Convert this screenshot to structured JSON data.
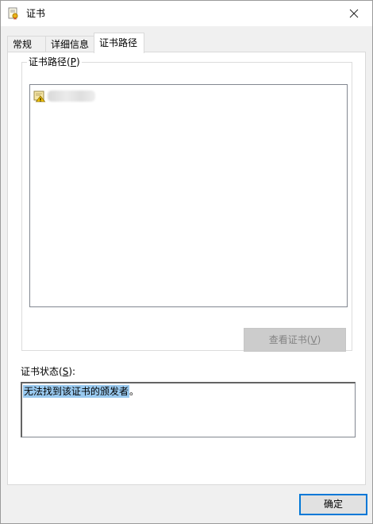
{
  "window": {
    "title": "证书"
  },
  "tabs": [
    {
      "label": "常规",
      "active": false
    },
    {
      "label": "详细信息",
      "active": false
    },
    {
      "label": "证书路径",
      "active": true
    }
  ],
  "cert_path_group": {
    "label": "证书路径(",
    "label_mnemonic": "P",
    "label_end": ")"
  },
  "view_button": {
    "label": "查看证书(",
    "mnemonic": "V",
    "end": ")",
    "enabled": false
  },
  "status": {
    "label": "证书状态(",
    "label_mnemonic": "S",
    "label_end": "):",
    "text": "无法找到该证书的颁发者",
    "text_end": "。"
  },
  "ok_button": {
    "label": "确定"
  },
  "colors": {
    "selection": "#99c9ef",
    "focus_border": "#0078d7",
    "disabled_button": "#cccccc"
  },
  "icons": [
    "certificate-icon",
    "close-icon",
    "certificate-warning-icon"
  ]
}
